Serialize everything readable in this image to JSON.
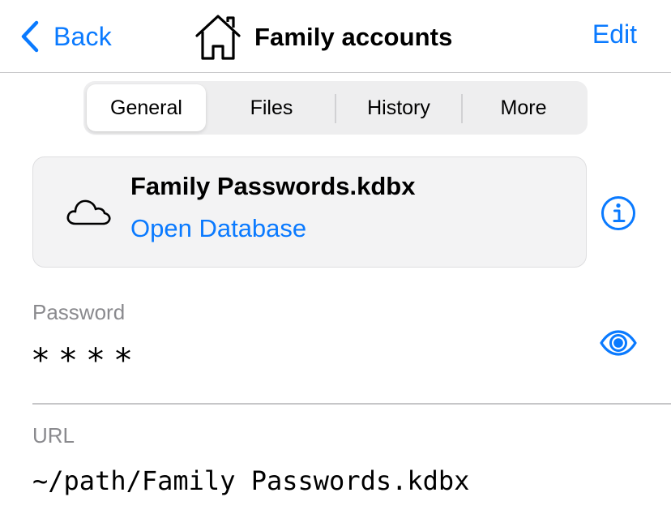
{
  "navbar": {
    "back_label": "Back",
    "title": "Family accounts",
    "title_icon": "house-icon",
    "edit_label": "Edit"
  },
  "tabs": [
    {
      "label": "General",
      "active": true
    },
    {
      "label": "Files",
      "active": false
    },
    {
      "label": "History",
      "active": false
    },
    {
      "label": "More",
      "active": false
    }
  ],
  "database_card": {
    "icon": "cloud-icon",
    "file_name": "Family Passwords.kdbx",
    "action_label": "Open Database",
    "info_icon": "info-icon"
  },
  "fields": {
    "password": {
      "label": "Password",
      "value": "****",
      "toggle_icon": "eye-icon"
    },
    "url": {
      "label": "URL",
      "value": "~/path/Family Passwords.kdbx"
    }
  },
  "colors": {
    "accent": "#0a7aff",
    "secondary_text": "#8a8a8e",
    "card_background": "#f3f3f4",
    "segmented_background": "#eeeeef",
    "separator": "#c6c6c8"
  }
}
